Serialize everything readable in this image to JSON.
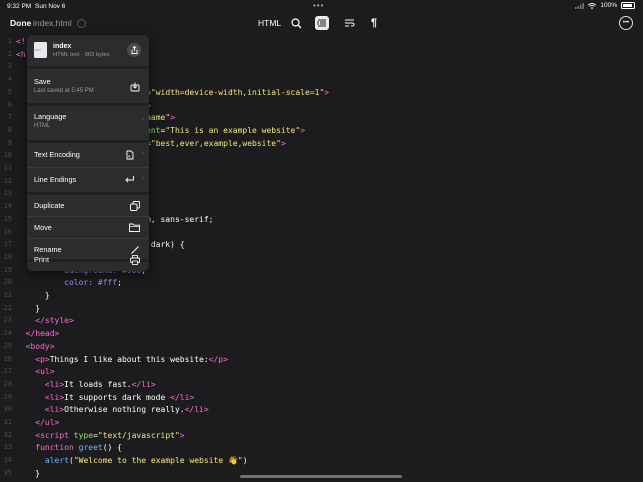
{
  "status_bar": {
    "time": "9:32 PM",
    "date": "Sun Nov 6",
    "battery": "100%"
  },
  "toolbar": {
    "done_label": "Done",
    "filename": "index.html",
    "language": "HTML",
    "icons": [
      "search-icon",
      "list-icon",
      "wrap-icon",
      "pilcrow-icon",
      "more-icon"
    ]
  },
  "menu": {
    "file_name": "index",
    "file_meta": "HTML text · 963 bytes",
    "items": [
      {
        "label": "Save",
        "sub": "Last saved at 5:45 PM",
        "icon": "save-icon"
      },
      {
        "label": "Language",
        "sub": "HTML",
        "icon": "chevron-right-icon"
      },
      {
        "label": "Text Encoding",
        "icon": "encoding-icon"
      },
      {
        "label": "Line Endings",
        "icon": "return-icon"
      },
      {
        "label": "Duplicate",
        "icon": "duplicate-icon"
      },
      {
        "label": "Move",
        "icon": "folder-icon"
      },
      {
        "label": "Rename",
        "icon": "pencil-icon"
      },
      {
        "label": "Print",
        "icon": "printer-icon"
      }
    ]
  },
  "editor": {
    "line_numbers": [
      "1",
      "2",
      "3",
      "4",
      "5",
      "6",
      "7",
      "8",
      "9",
      "10",
      "11",
      "12",
      "13",
      "14",
      "15",
      "16",
      "17",
      "18",
      "19",
      "20",
      "21",
      "22",
      "23",
      "24",
      "25",
      "26",
      "27",
      "28",
      "29",
      "30",
      "31",
      "32",
      "33",
      "34",
      "35"
    ],
    "lines": [
      [
        {
          "t": "<!",
          "c": "t-tag"
        }
      ],
      [
        {
          "t": "<h",
          "c": "t-tag"
        }
      ],
      [],
      [
        {
          "t": "                -8\"",
          "c": "t-str"
        },
        {
          "t": ">",
          "c": "t-tag"
        }
      ],
      [
        {
          "t": "                rt\" ",
          "c": "t-str"
        },
        {
          "t": "content",
          "c": "t-attr"
        },
        {
          "t": "=",
          "c": "t-txt"
        },
        {
          "t": "\"width=device-width,initial-scale=1\"",
          "c": "t-str"
        },
        {
          "t": ">",
          "c": "t-tag"
        }
      ],
      [
        {
          "t": "                site",
          "c": "t-txt"
        },
        {
          "t": "</title>",
          "c": "t-tag"
        }
      ],
      [
        {
          "t": "                \" ",
          "c": "t-str"
        },
        {
          "t": "content",
          "c": "t-attr"
        },
        {
          "t": "=",
          "c": "t-txt"
        },
        {
          "t": "\"name\"",
          "c": "t-str"
        },
        {
          "t": ">",
          "c": "t-tag"
        }
      ],
      [
        {
          "t": "                ption\" ",
          "c": "t-str"
        },
        {
          "t": "content",
          "c": "t-attr"
        },
        {
          "t": "=",
          "c": "t-txt"
        },
        {
          "t": "\"This is an example website\"",
          "c": "t-str"
        },
        {
          "t": ">",
          "c": "t-tag"
        }
      ],
      [
        {
          "t": "                ds\" ",
          "c": "t-str"
        },
        {
          "t": "content",
          "c": "t-attr"
        },
        {
          "t": "=",
          "c": "t-txt"
        },
        {
          "t": "\"best,ever,example,website\"",
          "c": "t-str"
        },
        {
          "t": ">",
          "c": "t-tag"
        }
      ],
      [
        {
          "t": "                css\"",
          "c": "t-str"
        },
        {
          "t": ">",
          "c": "t-tag"
        }
      ],
      [],
      [
        {
          "t": "                ff;",
          "c": "t-purple"
        }
      ],
      [],
      [
        {
          "t": "                em;",
          "c": "t-purple"
        }
      ],
      [
        {
          "t": "                apple-system, sans-serif;",
          "c": "t-txt"
        }
      ],
      [],
      [
        {
          "t": "                lor-scheme: ",
          "c": "t-dim"
        },
        {
          "t": "dark) {",
          "c": "t-txt"
        }
      ],
      [],
      [
        {
          "t": "          background: ",
          "c": "t-purple"
        },
        {
          "t": "#000",
          "c": "t-purple"
        },
        {
          "t": ";",
          "c": "t-txt"
        }
      ],
      [
        {
          "t": "          color: ",
          "c": "t-purple"
        },
        {
          "t": "#fff",
          "c": "t-purple"
        },
        {
          "t": ";",
          "c": "t-txt"
        }
      ],
      [
        {
          "t": "      }",
          "c": "t-txt"
        }
      ],
      [
        {
          "t": "    }",
          "c": "t-txt"
        }
      ],
      [
        {
          "t": "    ",
          "c": "t-txt"
        },
        {
          "t": "</style>",
          "c": "t-tag"
        }
      ],
      [
        {
          "t": "  ",
          "c": "t-txt"
        },
        {
          "t": "</head>",
          "c": "t-tag"
        }
      ],
      [
        {
          "t": "  ",
          "c": "t-txt"
        },
        {
          "t": "<body>",
          "c": "t-tag"
        }
      ],
      [
        {
          "t": "    ",
          "c": "t-txt"
        },
        {
          "t": "<p>",
          "c": "t-tag"
        },
        {
          "t": "Things I like about this website:",
          "c": "t-txt"
        },
        {
          "t": "</p>",
          "c": "t-tag"
        }
      ],
      [
        {
          "t": "    ",
          "c": "t-txt"
        },
        {
          "t": "<ul>",
          "c": "t-tag"
        }
      ],
      [
        {
          "t": "      ",
          "c": "t-txt"
        },
        {
          "t": "<li>",
          "c": "t-tag"
        },
        {
          "t": "It loads fast.",
          "c": "t-txt"
        },
        {
          "t": "</li>",
          "c": "t-tag"
        }
      ],
      [
        {
          "t": "      ",
          "c": "t-txt"
        },
        {
          "t": "<li>",
          "c": "t-tag"
        },
        {
          "t": "It supports dark mode ",
          "c": "t-txt"
        },
        {
          "t": "</li>",
          "c": "t-tag"
        }
      ],
      [
        {
          "t": "      ",
          "c": "t-txt"
        },
        {
          "t": "<li>",
          "c": "t-tag"
        },
        {
          "t": "Otherwise nothing really.",
          "c": "t-txt"
        },
        {
          "t": "</li>",
          "c": "t-tag"
        }
      ],
      [
        {
          "t": "    ",
          "c": "t-txt"
        },
        {
          "t": "</ul>",
          "c": "t-tag"
        }
      ],
      [
        {
          "t": "    ",
          "c": "t-txt"
        },
        {
          "t": "<script ",
          "c": "t-tag"
        },
        {
          "t": "type",
          "c": "t-attr"
        },
        {
          "t": "=",
          "c": "t-txt"
        },
        {
          "t": "\"text/javascript\"",
          "c": "t-str"
        },
        {
          "t": ">",
          "c": "t-tag"
        }
      ],
      [
        {
          "t": "    ",
          "c": "t-txt"
        },
        {
          "t": "function ",
          "c": "t-kw"
        },
        {
          "t": "greet",
          "c": "t-fn"
        },
        {
          "t": "() {",
          "c": "t-txt"
        }
      ],
      [
        {
          "t": "      ",
          "c": "t-txt"
        },
        {
          "t": "alert",
          "c": "t-fn"
        },
        {
          "t": "(",
          "c": "t-txt"
        },
        {
          "t": "\"Welcome to the example website 👋\"",
          "c": "t-str"
        },
        {
          "t": ")",
          "c": "t-txt"
        }
      ],
      [
        {
          "t": "    }",
          "c": "t-txt"
        }
      ]
    ]
  }
}
